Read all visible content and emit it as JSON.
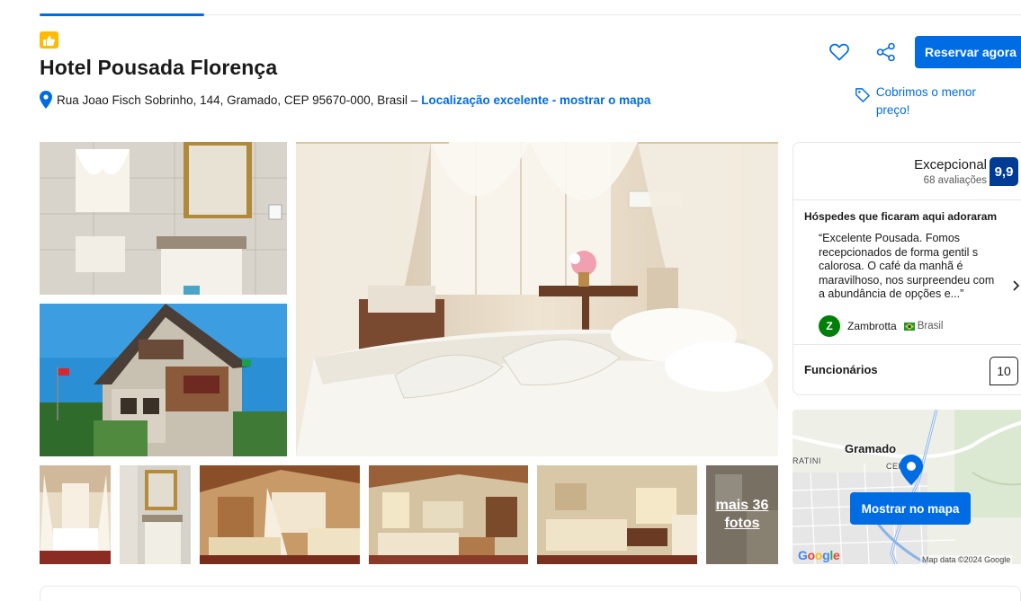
{
  "header": {
    "title": "Hotel Pousada Florença",
    "address": "Rua Joao Fisch Sobrinho, 144, Gramado, CEP 95670-000, Brasil –",
    "location_link": "Localização excelente - mostrar o mapa",
    "reserve_label": "Reservar agora",
    "price_match": "Cobrimos o menor preço!",
    "icons": {
      "badge": "thumbs-up-icon",
      "pin": "location-pin-icon",
      "heart": "heart-icon",
      "share": "share-icon",
      "tag": "price-tag-icon"
    }
  },
  "gallery": {
    "photos": [
      "bathroom",
      "hotel-exterior",
      "canopy-bed-room",
      "canopy-bed-thumb",
      "bathroom-mirror-thumb",
      "suite-room-thumb",
      "living-room-thumb",
      "lounge-thumb",
      "more-photos-thumb"
    ],
    "more_line1": "mais 36",
    "more_line2": "fotos"
  },
  "reviews": {
    "rating_word": "Excepcional",
    "rating_count": "68 avaliações",
    "score": "9,9",
    "guests_loved": "Hóspedes que ficaram aqui adoraram",
    "quote": "“Excelente Pousada. Fomos recepcionados de forma gentil s calorosa. O café da manhã é maravilhoso, nos surpreendeu com a abundância de opções e...”",
    "reviewer_initial": "Z",
    "reviewer_name": "Zambrotta",
    "reviewer_country": "Brasil",
    "staff_label": "Funcionários",
    "staff_score": "10"
  },
  "map": {
    "city": "Gramado",
    "centro": "CENTRO",
    "ratini": "RATINI",
    "button": "Mostrar no mapa",
    "google": "Google",
    "attribution": "Map data ©2024 Google"
  },
  "colors": {
    "accent": "#006ce4",
    "score_bg": "#003b95",
    "badge_yellow": "#febb02",
    "avatar_green": "#008009"
  }
}
